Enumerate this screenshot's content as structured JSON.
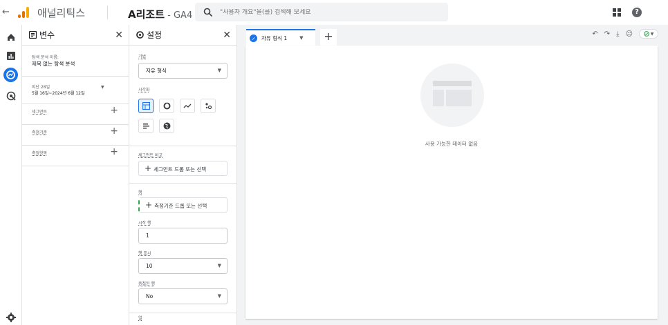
{
  "topbar": {
    "app_name": "애널리틱스",
    "property_name": "A리조트",
    "property_suffix": " - GA4",
    "search_placeholder": "\"사용자 개요\"을(를) 검색해 보세요",
    "back_icon": "arrow-left-icon",
    "apps_icon": "apps-grid-icon",
    "help_icon": "help-icon",
    "logo_colors": [
      "#f9ab00",
      "#e37400",
      "#e37400"
    ]
  },
  "leftnav": {
    "items": [
      {
        "icon": "home-icon"
      },
      {
        "icon": "reports-icon"
      },
      {
        "icon": "explore-icon",
        "active": true
      },
      {
        "icon": "advertising-icon"
      }
    ],
    "settings_icon": "settings-gear-icon"
  },
  "variables_panel": {
    "title": "변수",
    "exploration_name_label": "탐색 분석 이름:",
    "exploration_name": "제목 없는 탐색 분석",
    "date_label": "지난 28일",
    "date_range": "5월 16일~2024년 6월 12일",
    "segments_label": "세그먼트",
    "dimensions_label": "측정기준",
    "metrics_label": "측정항목"
  },
  "settings_panel": {
    "title": "설정",
    "technique_label": "기법",
    "technique_value": "자유 형식",
    "visualization_label": "시각화",
    "segment_compare_label": "세그먼트 비교",
    "segment_drop": "세그먼트 드롭 또는 선택",
    "rows_label": "행",
    "dimension_drop": "측정기준 드롭 또는 선택",
    "start_row_label": "시작 행",
    "start_row_value": "1",
    "show_rows_label": "행 표시",
    "show_rows_value": "10",
    "nested_rows_label": "중첩된 행",
    "nested_rows_value": "No",
    "columns_label": "열"
  },
  "canvas": {
    "tab_label": "자유 형식 1",
    "empty_message": "사용 가능한 데이터 없음",
    "accent": "#1a73e8",
    "status_color": "#34a853"
  }
}
